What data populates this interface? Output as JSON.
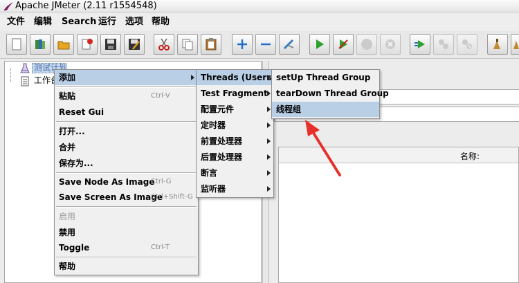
{
  "window": {
    "title": "Apache JMeter (2.11 r1554548)"
  },
  "menubar": [
    "文件",
    "编辑",
    "Search",
    "运行",
    "选项",
    "帮助"
  ],
  "toolbar": [
    {
      "icon": "new-icon",
      "enabled": true
    },
    {
      "icon": "templates-icon",
      "enabled": true
    },
    {
      "icon": "open-icon",
      "enabled": true
    },
    {
      "icon": "close-icon",
      "enabled": true
    },
    {
      "icon": "save-icon",
      "enabled": true
    },
    {
      "icon": "save-as-icon",
      "enabled": true
    },
    {
      "icon": "cut-icon",
      "enabled": true
    },
    {
      "icon": "copy-icon",
      "enabled": true
    },
    {
      "icon": "paste-icon",
      "enabled": true
    },
    {
      "icon": "expand-icon",
      "enabled": true
    },
    {
      "icon": "collapse-icon",
      "enabled": true
    },
    {
      "icon": "toggle-icon",
      "enabled": true
    },
    {
      "icon": "start-icon",
      "enabled": true
    },
    {
      "icon": "start-no-pause-icon",
      "enabled": true
    },
    {
      "icon": "stop-icon",
      "enabled": false
    },
    {
      "icon": "shutdown-icon",
      "enabled": false
    },
    {
      "icon": "remote-start-icon",
      "enabled": true
    },
    {
      "icon": "remote-stop-icon",
      "enabled": false
    },
    {
      "icon": "remote-shutdown-icon",
      "enabled": false
    },
    {
      "icon": "clear-icon",
      "enabled": true
    },
    {
      "icon": "clear-all-icon",
      "enabled": true
    }
  ],
  "tree": {
    "items": [
      {
        "label": "测试计划",
        "icon": "test-plan-icon",
        "selected": true
      },
      {
        "label": "工作台",
        "icon": "workbench-icon",
        "selected": false
      }
    ]
  },
  "right_panel": {
    "table_header": "名称:"
  },
  "context_menu": {
    "items": [
      {
        "label": "添加",
        "submenu": true,
        "highlighted": true
      },
      {
        "sep": true
      },
      {
        "label": "粘贴",
        "accel": "Ctrl-V"
      },
      {
        "label": "Reset Gui"
      },
      {
        "sep": true
      },
      {
        "label": "打开..."
      },
      {
        "label": "合并"
      },
      {
        "label": "保存为..."
      },
      {
        "sep": true
      },
      {
        "label": "Save Node As Image",
        "accel": "Ctrl-G"
      },
      {
        "label": "Save Screen As Image",
        "accel": "Ctrl+Shift-G"
      },
      {
        "sep": true
      },
      {
        "label": "启用",
        "disabled": true
      },
      {
        "label": "禁用"
      },
      {
        "label": "Toggle",
        "accel": "Ctrl-T"
      },
      {
        "sep": true
      },
      {
        "label": "帮助"
      }
    ]
  },
  "add_submenu": {
    "items": [
      {
        "label": "Threads (Users)",
        "submenu": true,
        "highlighted": true
      },
      {
        "label": "Test Fragment",
        "submenu": true
      },
      {
        "label": "配置元件",
        "submenu": true
      },
      {
        "label": "定时器",
        "submenu": true
      },
      {
        "label": "前置处理器",
        "submenu": true
      },
      {
        "label": "后置处理器",
        "submenu": true
      },
      {
        "label": "断言",
        "submenu": true
      },
      {
        "label": "监听器",
        "submenu": true
      }
    ]
  },
  "threads_submenu": {
    "items": [
      {
        "label": "setUp Thread Group"
      },
      {
        "label": "tearDown Thread Group"
      },
      {
        "label": "线程组",
        "highlighted": true
      }
    ]
  },
  "colors": {
    "highlight": "#b8cfe5",
    "annotation_arrow": "#e8302a",
    "tree_selection": "#c6d8ec"
  }
}
